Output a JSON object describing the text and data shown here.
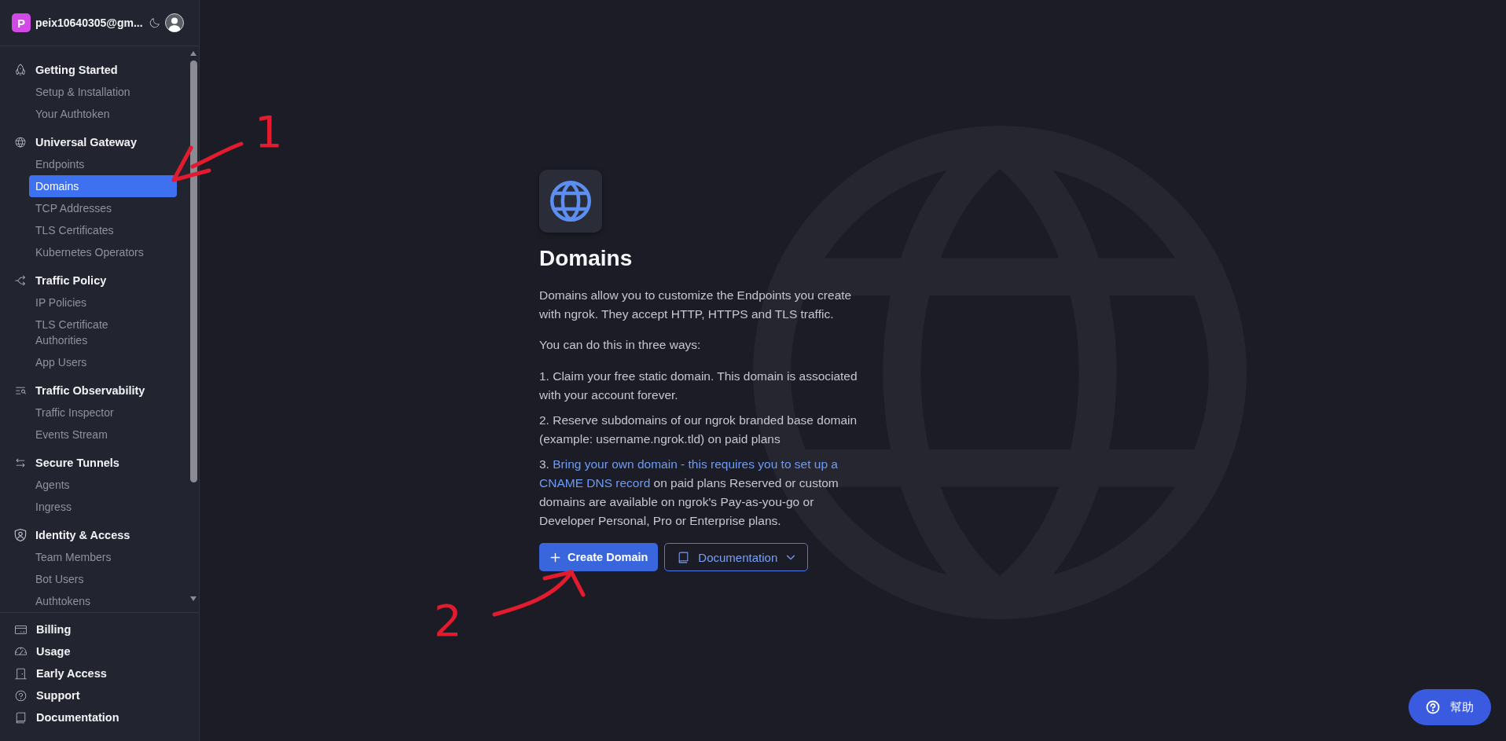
{
  "sidebar": {
    "account": {
      "initial": "P",
      "email": "peix10640305@gm..."
    },
    "sections": [
      {
        "title": "Getting Started",
        "items": [
          {
            "label": "Setup & Installation",
            "selected": false
          },
          {
            "label": "Your Authtoken",
            "selected": false
          }
        ]
      },
      {
        "title": "Universal Gateway",
        "items": [
          {
            "label": "Endpoints",
            "selected": false
          },
          {
            "label": "Domains",
            "selected": true
          },
          {
            "label": "TCP Addresses",
            "selected": false
          },
          {
            "label": "TLS Certificates",
            "selected": false
          },
          {
            "label": "Kubernetes Operators",
            "selected": false
          }
        ]
      },
      {
        "title": "Traffic Policy",
        "items": [
          {
            "label": "IP Policies",
            "selected": false
          },
          {
            "label": "TLS Certificate Authorities",
            "selected": false
          },
          {
            "label": "App Users",
            "selected": false
          }
        ]
      },
      {
        "title": "Traffic Observability",
        "items": [
          {
            "label": "Traffic Inspector",
            "selected": false
          },
          {
            "label": "Events Stream",
            "selected": false
          }
        ]
      },
      {
        "title": "Secure Tunnels",
        "items": [
          {
            "label": "Agents",
            "selected": false
          },
          {
            "label": "Ingress",
            "selected": false
          }
        ]
      },
      {
        "title": "Identity & Access",
        "items": [
          {
            "label": "Team Members",
            "selected": false
          },
          {
            "label": "Bot Users",
            "selected": false
          },
          {
            "label": "Authtokens",
            "selected": false
          }
        ]
      }
    ],
    "footer_links": [
      "Billing",
      "Usage",
      "Early Access",
      "Support",
      "Documentation"
    ]
  },
  "page": {
    "title": "Domains",
    "intro": "Domains allow you to customize the Endpoints you create with ngrok. They accept HTTP, HTTPS and TLS traffic.",
    "lead": "You can do this in three ways:",
    "steps": [
      {
        "segments": [
          {
            "kind": "text",
            "text": "1. Claim your free static domain. This domain is associated with your account forever."
          }
        ]
      },
      {
        "segments": [
          {
            "kind": "text",
            "text": "2. Reserve subdomains of our ngrok branded base domain (example: username.ngrok.tld) on paid plans"
          }
        ]
      },
      {
        "segments": [
          {
            "kind": "text",
            "text": "3."
          },
          {
            "kind": "link",
            "text": "Bring your own domain - this requires you to set up a"
          },
          {
            "kind": "link",
            "text": "CNAME DNS record"
          },
          {
            "kind": "text",
            "text": "on paid plans Reserved or custom domains are available on ngrok's Pay-as-you-go or Developer Personal, Pro or Enterprise plans."
          }
        ]
      }
    ],
    "buttons": [
      {
        "kind": "primary",
        "label": "Create Domain"
      },
      {
        "kind": "dropdown",
        "label": "Documentation"
      }
    ]
  },
  "help_button": {
    "label": "幫助"
  },
  "annotations": [
    {
      "label": "1"
    },
    {
      "label": "2"
    }
  ]
}
